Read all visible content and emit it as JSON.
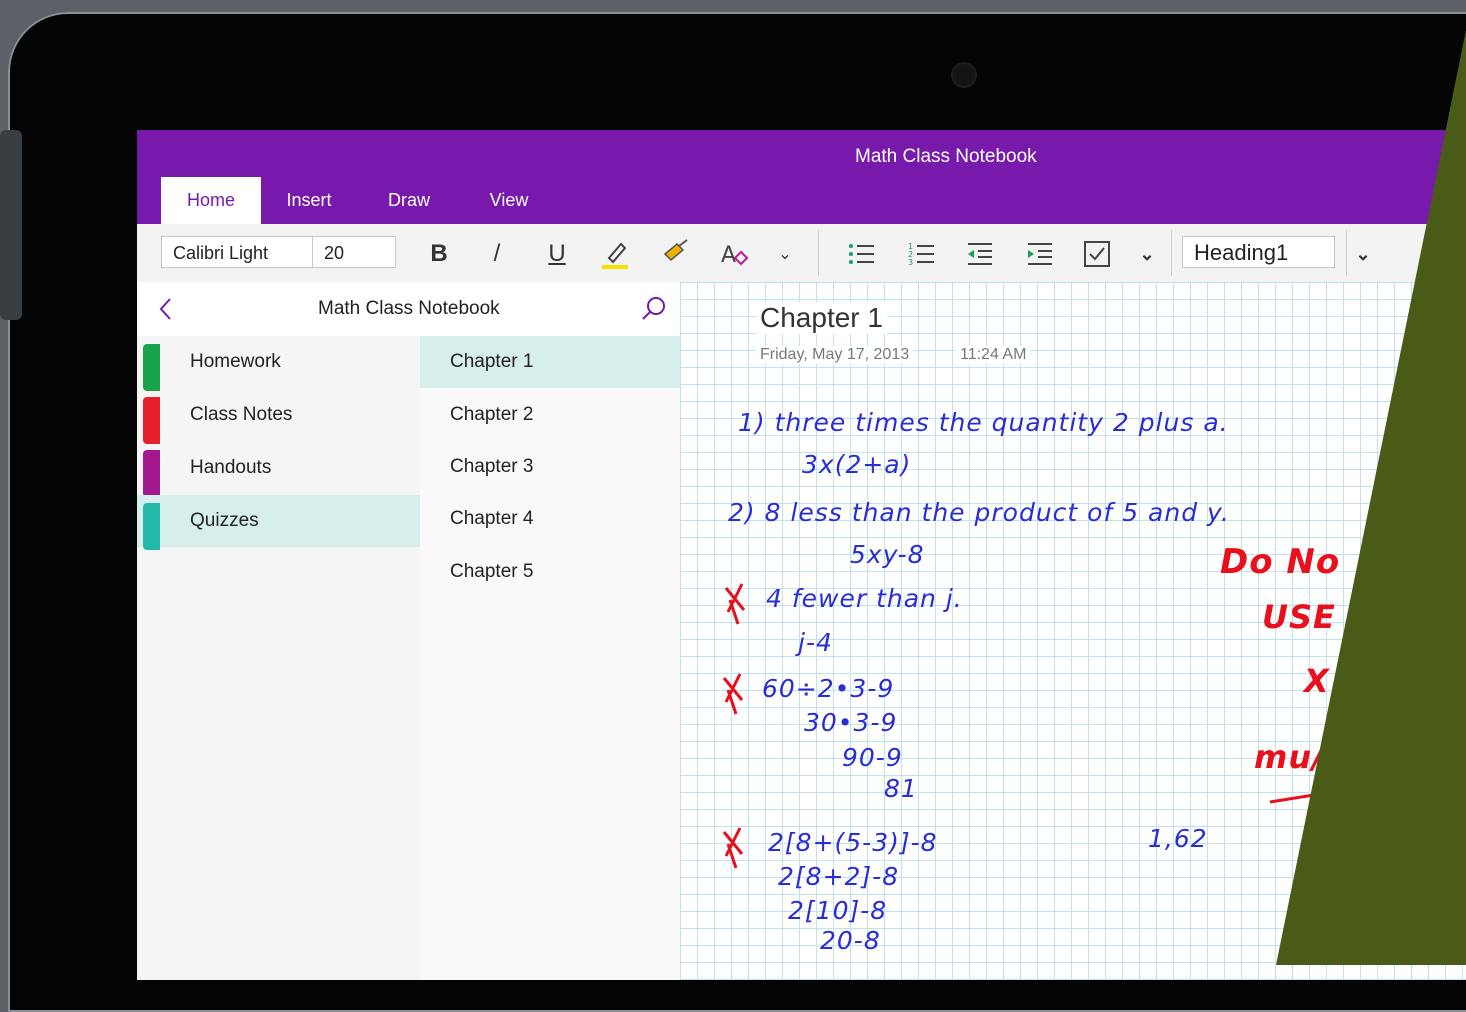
{
  "app": {
    "window_title": "Math Class Notebook",
    "tabs": [
      "Home",
      "Insert",
      "Draw",
      "View"
    ],
    "active_tab": "Home"
  },
  "ribbon": {
    "font_name": "Calibri Light",
    "font_size": "20",
    "bold": "B",
    "italic": "/",
    "underline": "U",
    "style": "Heading1"
  },
  "navigation": {
    "notebook_title": "Math Class Notebook",
    "sections": [
      {
        "label": "Homework",
        "color": "#19a34a"
      },
      {
        "label": "Class Notes",
        "color": "#e3202c"
      },
      {
        "label": "Handouts",
        "color": "#a3178f"
      },
      {
        "label": "Quizzes",
        "color": "#23b9a8"
      }
    ],
    "active_section": "Quizzes",
    "pages": [
      "Chapter 1",
      "Chapter 2",
      "Chapter 3",
      "Chapter 4",
      "Chapter 5"
    ],
    "active_page": "Chapter 1"
  },
  "page": {
    "title": "Chapter 1",
    "date": "Friday, May 17, 2013",
    "time": "11:24 AM",
    "ink": [
      "1) three times the quantity 2 plus a.",
      "3x(2+a)",
      "2) 8 less than the product of 5 and y.",
      "5xy-8",
      "4 fewer than j.",
      "j-4",
      "60÷2•3-9",
      "30•3-9",
      "90-9",
      "81",
      "2[8+(5-3)]-8",
      "2[8+2]-8",
      "2[10]-8",
      "20-8",
      "1,62"
    ],
    "red_ink": [
      "Do No",
      "USE",
      "X",
      "mu/"
    ]
  },
  "colors": {
    "brand": "#7719aa",
    "accent": "#d6eeec",
    "ink": "#2a2cd6",
    "red_ink": "#e8101c",
    "olive": "#4a5a17"
  }
}
